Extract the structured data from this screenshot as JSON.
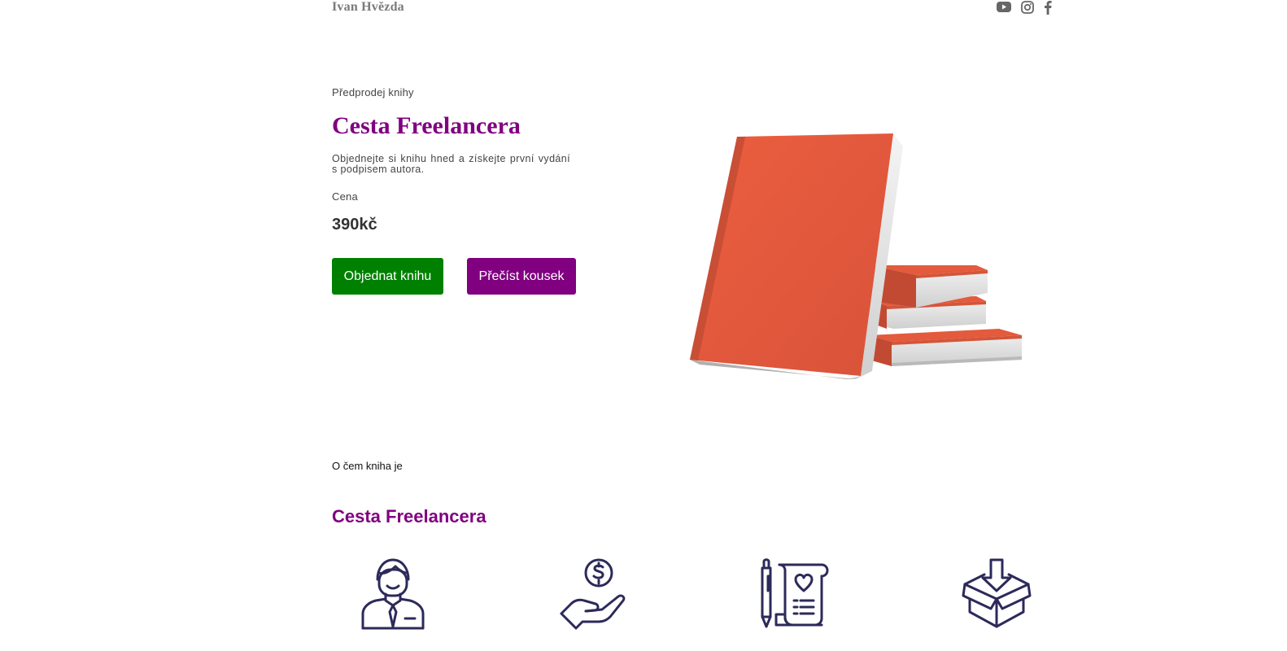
{
  "header": {
    "brand": "Ivan Hvězda",
    "socials": [
      {
        "icon": "youtube-icon"
      },
      {
        "icon": "instagram-icon"
      },
      {
        "icon": "facebook-icon"
      }
    ]
  },
  "hero": {
    "eyebrow": "Předprodej knihy",
    "title": "Cesta Freelancera",
    "description": "Objednejte si knihu hned a získejte první vydání s podpisem autora.",
    "price_label": "Cena",
    "price": "390kč",
    "order_button": "Objednat knihu",
    "read_button": "Přečíst kousek"
  },
  "about": {
    "eyebrow": "O čem kniha je",
    "title": "Cesta Freelancera",
    "features": [
      {
        "icon": "freelancer-person-icon"
      },
      {
        "icon": "money-hand-icon"
      },
      {
        "icon": "pen-scroll-icon"
      },
      {
        "icon": "box-download-icon"
      }
    ]
  },
  "colors": {
    "accent": "#800080",
    "order_button": "#008000",
    "book_cover": "#e35a3c",
    "icon_stroke": "#2c2a5a"
  }
}
